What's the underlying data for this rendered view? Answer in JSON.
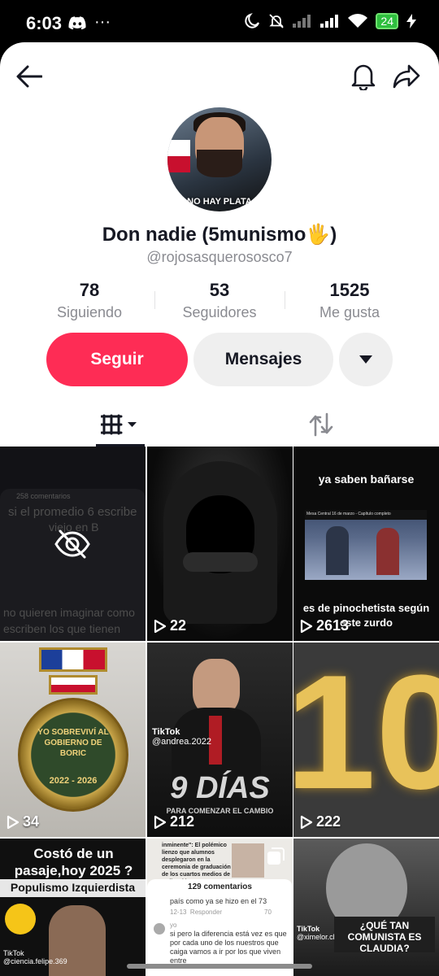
{
  "status_bar": {
    "time": "6:03",
    "more": "···",
    "battery": "24"
  },
  "profile": {
    "avatar_caption": "NO HAY PLATA",
    "display_name": "Don nadie (5munismo🖐)",
    "username": "@rojosasquerososco7",
    "stats": [
      {
        "value": "78",
        "label": "Siguiendo"
      },
      {
        "value": "53",
        "label": "Seguidores"
      },
      {
        "value": "1525",
        "label": "Me gusta"
      }
    ]
  },
  "actions": {
    "follow_label": "Seguir",
    "message_label": "Mensajes"
  },
  "videos": [
    {
      "views": "",
      "hidden": true,
      "lines": [
        "258 comentarios",
        "si el promedio 6 escribe",
        "viejo en B",
        "no quieren imaginar como",
        "escriben los que tienen"
      ]
    },
    {
      "views": "22"
    },
    {
      "views": "2613",
      "top_text": "ya saben bañarse",
      "bottom_text": "es de pinochetista según este zurdo",
      "tv_caption": "Mesa Central 16 de marzo - Capítulo completo"
    },
    {
      "views": "34",
      "medal_text": "YO SOBREVIVÍ AL GOBIERNO DE BORIC",
      "medal_years": "2022 - 2026"
    },
    {
      "views": "212",
      "watermark": "TikTok",
      "watermark_user": "@andrea.2022",
      "big_text": "9 DÍAS",
      "small_text": "PARA COMENZAR EL CAMBIO"
    },
    {
      "views": "222",
      "big_text": "10"
    },
    {
      "views": "",
      "top_text": "Costó de un pasaje,hoy 2025 ?",
      "sub_text": "Populismo Izquierdista",
      "watermark": "TikTok",
      "watermark_user": "@ciencia.felipe.369"
    },
    {
      "views": "",
      "top_text": "inminente\": El polémico lienzo que alumnos desplegaron en la ceremonia de graduación de los cuartos medios de Aplicación",
      "comments_title": "129 comentarios",
      "comment_1": "país como ya se hizo en el 73",
      "comment_1_time": "12-13",
      "comment_1_reply": "Responder",
      "comment_1_likes": "70",
      "comment_2_user": "yo",
      "comment_2": "si pero la diferencia está vez es que por cada uno de los nuestros que caiga vamos a ir por los que viven entre"
    },
    {
      "views": "",
      "bottom_text": "¿QUÉ TAN COMUNISTA ES CLAUDIA?",
      "watermark": "TikTok",
      "watermark_user": "@ximelor.cl"
    }
  ]
}
